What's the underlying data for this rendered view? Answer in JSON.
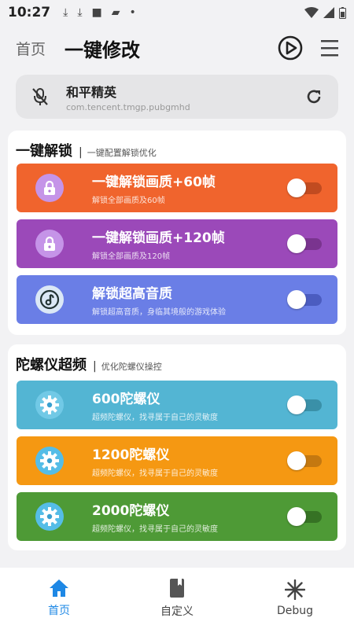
{
  "status_bar": {
    "time": "10:27"
  },
  "app_bar": {
    "back_label": "首页",
    "title": "一键修改"
  },
  "app_card": {
    "name": "和平精英",
    "package": "com.tencent.tmgp.pubgmhd"
  },
  "sections": [
    {
      "title": "一键解锁",
      "subtitle": "一键配置解锁优化",
      "items": [
        {
          "title": "一键解锁画质+60帧",
          "desc": "解锁全部画质及60帧",
          "color": "#f0642d",
          "track": "#c14b20",
          "icon": "lock-icon",
          "enabled": false
        },
        {
          "title": "一键解锁画质+120帧",
          "desc": "解锁全部画质及120帧",
          "color": "#9b49b9",
          "track": "#7a348f",
          "icon": "lock-icon",
          "enabled": false
        },
        {
          "title": "解锁超高音质",
          "desc": "解锁超高音质，身临其境般的游戏体验",
          "color": "#6a7ee6",
          "track": "#4b5cc0",
          "icon": "music-note-icon",
          "enabled": false
        }
      ]
    },
    {
      "title": "陀螺仪超频",
      "subtitle": "优化陀螺仪操控",
      "items": [
        {
          "title": "600陀螺仪",
          "desc": "超频陀螺仪，找寻属于自己的灵敏度",
          "color": "#53b5d3",
          "track": "#3a90a8",
          "icon": "gear-icon",
          "enabled": false
        },
        {
          "title": "1200陀螺仪",
          "desc": "超频陀螺仪，找寻属于自己的灵敏度",
          "color": "#f59812",
          "track": "#c47810",
          "icon": "gear-icon",
          "enabled": false
        },
        {
          "title": "2000陀螺仪",
          "desc": "超频陀螺仪，找寻属于自己的灵敏度",
          "color": "#4e9a36",
          "track": "#367224",
          "icon": "gear-icon",
          "enabled": false
        }
      ]
    }
  ],
  "bottom_nav": [
    {
      "label": "首页",
      "icon": "home-icon",
      "active": true
    },
    {
      "label": "自定义",
      "icon": "book-icon",
      "active": false
    },
    {
      "label": "Debug",
      "icon": "snowflake-icon",
      "active": false
    }
  ],
  "colors": {
    "accent": "#1e88e5",
    "background": "#f2f2f4"
  }
}
